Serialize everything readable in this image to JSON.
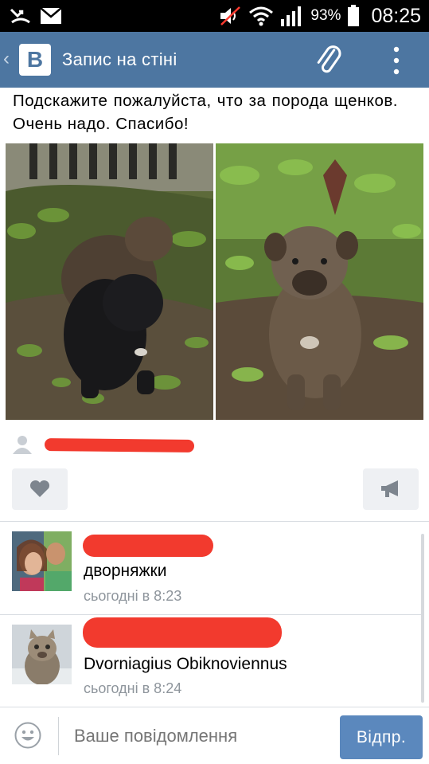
{
  "status_bar": {
    "battery_percent": "93%",
    "time": "08:25",
    "icons": [
      "missed-call-icon",
      "mail-icon",
      "mute-icon",
      "wifi-icon",
      "signal-icon",
      "battery-icon"
    ]
  },
  "header": {
    "logo_text": "B",
    "title": "Запис на стіні",
    "icons": [
      "back-chevron-icon",
      "paperclip-icon",
      "more-vertical-icon"
    ],
    "color": "#4d76a1"
  },
  "post": {
    "text": "Подскажите пожалуйста, что за порода щенков. Очень надо. Спасибо!",
    "photos": [
      "puppies-photo-1",
      "puppy-photo-2"
    ]
  },
  "actions": {
    "like_icon": "heart-icon",
    "share_icon": "megaphone-icon"
  },
  "comments": [
    {
      "text": "дворняжки",
      "time": "сьогодні в 8:23"
    },
    {
      "text": "Dvorniagius Obiknoviennus",
      "time": "сьогодні в 8:24"
    }
  ],
  "composer": {
    "placeholder": "Ваше повідомлення",
    "send_label": "Відпр.",
    "send_color": "#5b88bd"
  }
}
